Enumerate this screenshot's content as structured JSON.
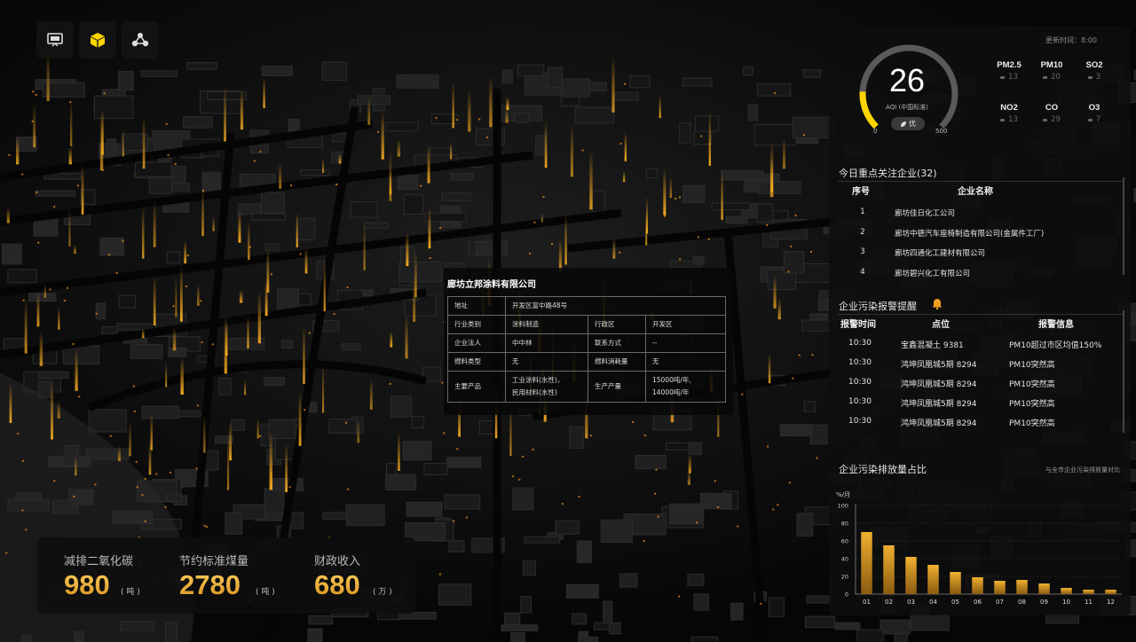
{
  "toolbar": {
    "icons": [
      "monitor-icon",
      "cube-icon",
      "network-icon"
    ]
  },
  "aqi": {
    "update_time": "更新时间：8:00",
    "value": "26",
    "label": "AQI (中国标准)",
    "level": "优",
    "min": "0",
    "max": "500",
    "level_fraction": 0.052,
    "accent_color": "#ffd400"
  },
  "pollutants": [
    {
      "name": "PM2.5",
      "value": "13"
    },
    {
      "name": "PM10",
      "value": "20"
    },
    {
      "name": "SO2",
      "value": "3"
    },
    {
      "name": "NO2",
      "value": "13"
    },
    {
      "name": "CO",
      "value": "29"
    },
    {
      "name": "O3",
      "value": "7"
    }
  ],
  "companies": {
    "title": "今日重点关注企业(32)",
    "headers": [
      "序号",
      "企业名称"
    ],
    "rows": [
      {
        "idx": "1",
        "name": "廊坊佳日化工公司"
      },
      {
        "idx": "2",
        "name": "廊坊中德汽车座椅制造有限公司(金属件工厂)"
      },
      {
        "idx": "3",
        "name": "廊坊四通化工建材有限公司"
      },
      {
        "idx": "4",
        "name": "廊坊碧兴化工有限公司"
      }
    ]
  },
  "alerts": {
    "title": "企业污染报警提醒",
    "headers": [
      "报警时间",
      "点位",
      "报警信息"
    ],
    "rows": [
      {
        "time": "10:30",
        "place": "宝鑫混凝土 9381",
        "info": "PM10超过市区均值150%"
      },
      {
        "time": "10:30",
        "place": "鸿坤凤凰城5期 8294",
        "info": "PM10突然高"
      },
      {
        "time": "10:30",
        "place": "鸿坤凤凰城5期 8294",
        "info": "PM10突然高"
      },
      {
        "time": "10:30",
        "place": "鸿坤凤凰城5期 8294",
        "info": "PM10突然高"
      },
      {
        "time": "10:30",
        "place": "鸿坤凤凰城5期 8294",
        "info": "PM10突然高"
      }
    ]
  },
  "chart_section": {
    "title": "企业污染排放量占比",
    "subtitle": "与全市企业污染排放量对比"
  },
  "chart_data": {
    "type": "bar",
    "ylabel": "%/月",
    "ylim": [
      0,
      100
    ],
    "yticks": [
      "0",
      "20",
      "40",
      "60",
      "80",
      "100"
    ],
    "categories": [
      "01",
      "02",
      "03",
      "04",
      "05",
      "06",
      "07",
      "08",
      "09",
      "10",
      "11",
      "12"
    ],
    "values": [
      70,
      55,
      42,
      33,
      25,
      19,
      15,
      16,
      12,
      7,
      5,
      5
    ],
    "bar_color": "#f0b030",
    "grid": true
  },
  "popup": {
    "title": "廊坊立邦涂料有限公司",
    "address_label": "地址",
    "address": "开发区富中路48号",
    "industry_label": "行业类别",
    "industry": "涂料制造",
    "district_label": "行政区",
    "district": "开发区",
    "legal_label": "企业法人",
    "legal": "中中林",
    "contact_label": "联系方式",
    "contact": "--",
    "fuel_type_label": "燃料类型",
    "fuel_type": "无",
    "fuel_use_label": "燃料消耗量",
    "fuel_use": "无",
    "product_label": "主要产品",
    "product_1": "工业涂料(水性)，",
    "product_2": "民用材料(水性)",
    "output_label": "生产产量",
    "output_1": "15000吨/年,",
    "output_2": "14000吨/年"
  },
  "stats": [
    {
      "label": "减排二氧化碳",
      "value": "980",
      "unit": "( 吨 )"
    },
    {
      "label": "节约标准煤量",
      "value": "2780",
      "unit": "( 吨 )"
    },
    {
      "label": "财政收入",
      "value": "680",
      "unit": "( 万 )"
    }
  ]
}
